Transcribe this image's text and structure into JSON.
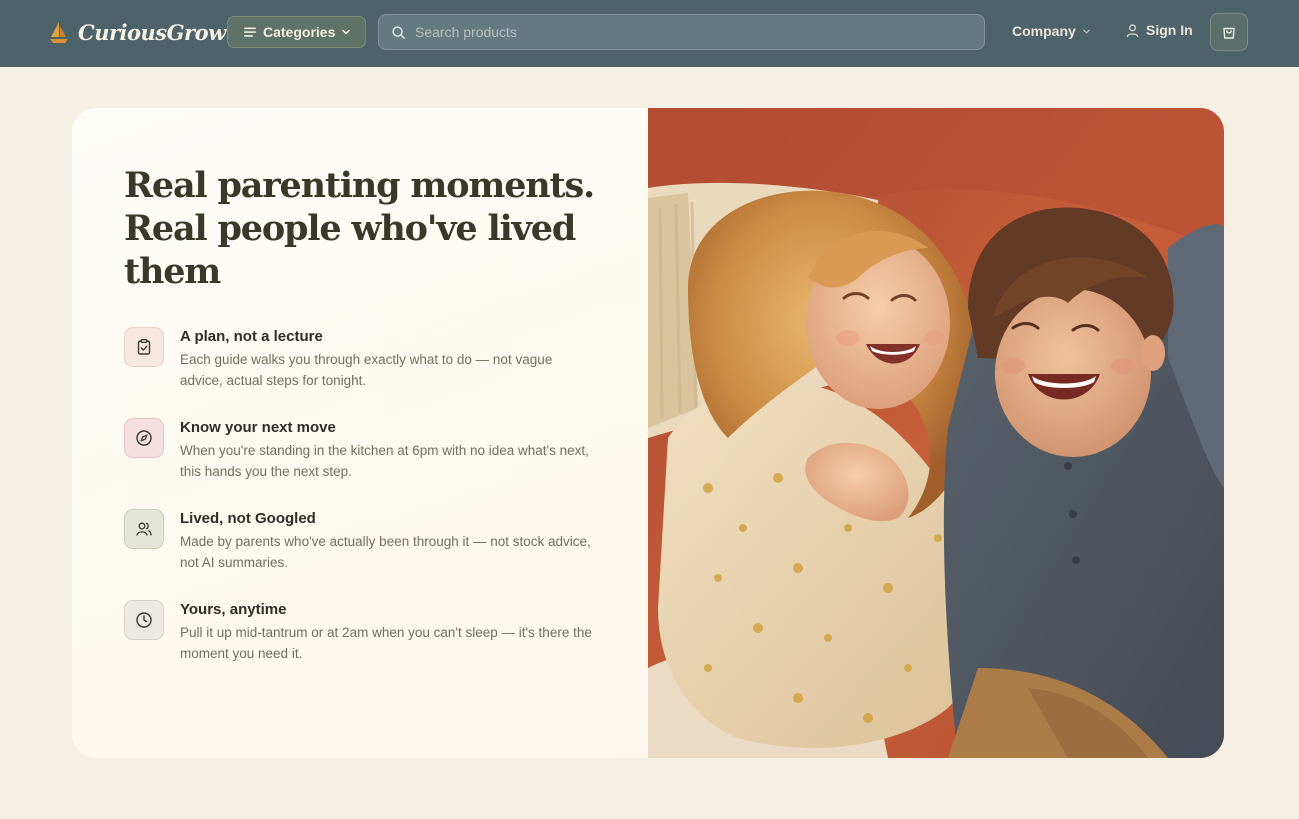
{
  "header": {
    "brand_name": "CuriousGrow",
    "categories_label": "Categories",
    "search_placeholder": "Search products",
    "company_label": "Company",
    "signin_label": "Sign In"
  },
  "hero": {
    "title": "Real parenting moments. Real people who've lived them",
    "features": [
      {
        "icon": "clipboard-check-icon",
        "title": "A plan, not a lecture",
        "description": "Each guide walks you through exactly what to do — not vague advice, actual steps for tonight."
      },
      {
        "icon": "compass-icon",
        "title": "Know your next move",
        "description": "When you're standing in the kitchen at 6pm with no idea what's next, this hands you the next step."
      },
      {
        "icon": "users-icon",
        "title": "Lived, not Googled",
        "description": "Made by parents who've actually been through it — not stock advice, not AI summaries."
      },
      {
        "icon": "clock-icon",
        "title": "Yours, anytime",
        "description": "Pull it up mid-tantrum or at 2am when you can't sleep — it's there the moment you need it."
      }
    ]
  },
  "colors": {
    "header_bg": "#4d6369",
    "page_bg": "#f6efe3",
    "title_text": "#3a3828",
    "body_text": "#6f705f"
  }
}
